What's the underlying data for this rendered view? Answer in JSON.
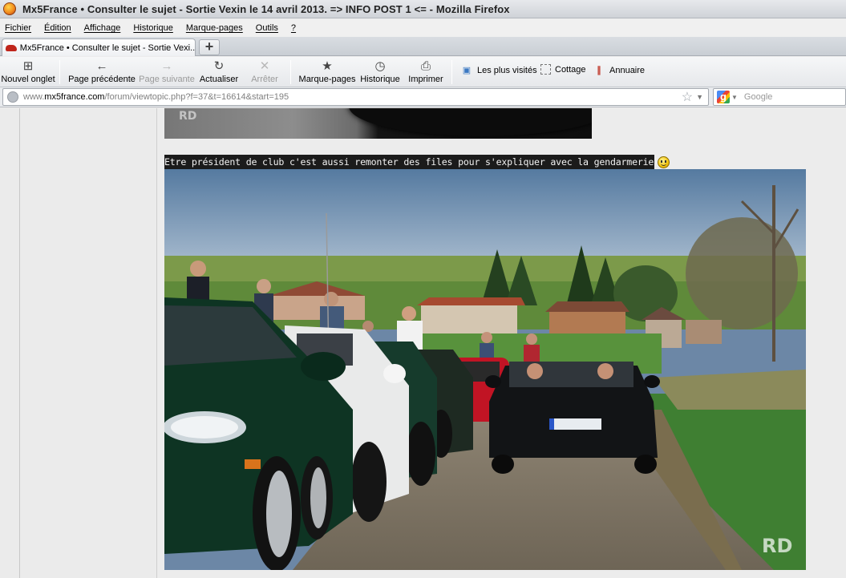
{
  "window": {
    "title": "Mx5France • Consulter le sujet - Sortie Vexin le 14 avril 2013. => INFO POST 1 <= - Mozilla Firefox"
  },
  "menu": {
    "items": [
      "Fichier",
      "Édition",
      "Affichage",
      "Historique",
      "Marque-pages",
      "Outils",
      "?"
    ]
  },
  "tabs": [
    {
      "label": "Mx5France • Consulter le sujet - Sortie Vexi..."
    }
  ],
  "toolbar": {
    "new_tab": "Nouvel onglet",
    "back": "Page précédente",
    "forward": "Page suivante",
    "reload": "Actualiser",
    "stop": "Arrêter",
    "bookmarks": "Marque-pages",
    "history": "Historique",
    "print": "Imprimer"
  },
  "bookmarks_bar": {
    "items": [
      "Les plus visités",
      "Cottage",
      "Annuaire"
    ]
  },
  "location": {
    "url_prefix": "www.",
    "url_domain": "mx5france.com",
    "url_path": "/forum/viewtopic.php?f=37&t=16614&start=195"
  },
  "search": {
    "placeholder": "Google"
  },
  "post": {
    "caption": "Etre président de club c'est aussi remonter des files pour s'expliquer avec la gendarmerie",
    "watermark": "RD"
  },
  "colors": {
    "caption_bg": "#1b1b1b",
    "page_bg": "#ececec"
  }
}
